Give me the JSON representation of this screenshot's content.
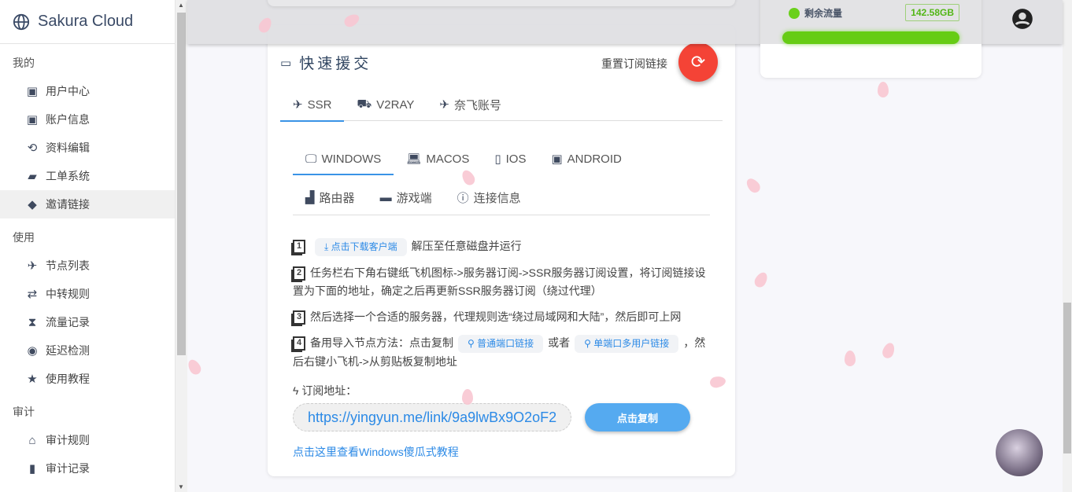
{
  "sidebar": {
    "brand": "Sakura Cloud",
    "sections": [
      {
        "title": "我的",
        "items": [
          {
            "label": "用户中心",
            "icon": "wallet-icon"
          },
          {
            "label": "账户信息",
            "icon": "account-box-icon"
          },
          {
            "label": "资料编辑",
            "icon": "sync-icon"
          },
          {
            "label": "工单系统",
            "icon": "forum-icon"
          },
          {
            "label": "邀请链接",
            "icon": "tag-icon",
            "active": true
          }
        ]
      },
      {
        "title": "使用",
        "items": [
          {
            "label": "节点列表",
            "icon": "airplane-icon"
          },
          {
            "label": "中转规则",
            "icon": "transfer-icon"
          },
          {
            "label": "流量记录",
            "icon": "hourglass-icon"
          },
          {
            "label": "延迟检测",
            "icon": "eye-icon"
          },
          {
            "label": "使用教程",
            "icon": "star-icon"
          }
        ]
      },
      {
        "title": "审计",
        "items": [
          {
            "label": "审计规则",
            "icon": "bank-icon"
          },
          {
            "label": "审计记录",
            "icon": "clipboard-icon"
          }
        ]
      }
    ]
  },
  "traffic": {
    "label": "剩余流量",
    "value": "142.58GB",
    "fill_percent": 100
  },
  "main": {
    "title": "快速援交",
    "reset_label": "重置订阅链接",
    "protocol_tabs": [
      "SSR",
      "V2RAY",
      "奈飞账号"
    ],
    "platform_tabs": [
      "WINDOWS",
      "MACOS",
      "IOS",
      "ANDROID"
    ],
    "platform_tabs2": [
      "路由器",
      "游戏端",
      "连接信息"
    ],
    "steps": {
      "s1_num": "1",
      "s1_chip": "点击下载客户端",
      "s1_text": "解压至任意磁盘并运行",
      "s2_num": "2",
      "s2_text": "任务栏右下角右键纸飞机图标->服务器订阅->SSR服务器订阅设置，将订阅链接设置为下面的地址，确定之后再更新SSR服务器订阅（绕过代理）",
      "s3_num": "3",
      "s3_text": "然后选择一个合适的服务器，代理规则选“绕过局域网和大陆”，然后即可上网",
      "s4_num": "4",
      "s4_pre": "备用导入节点方法：点击复制",
      "s4_chip1": "普通端口链接",
      "s4_or": "或者",
      "s4_chip2": "单端口多用户链接",
      "s4_post": "，然后右键小飞机->从剪贴板复制地址"
    },
    "sub_label": "订阅地址：",
    "sub_url": "https://yingyun.me/link/9a9lwBx9O2oF2",
    "copy_label": "点击复制",
    "tutorial_link": "点击这里查看Windows傻瓜式教程"
  }
}
